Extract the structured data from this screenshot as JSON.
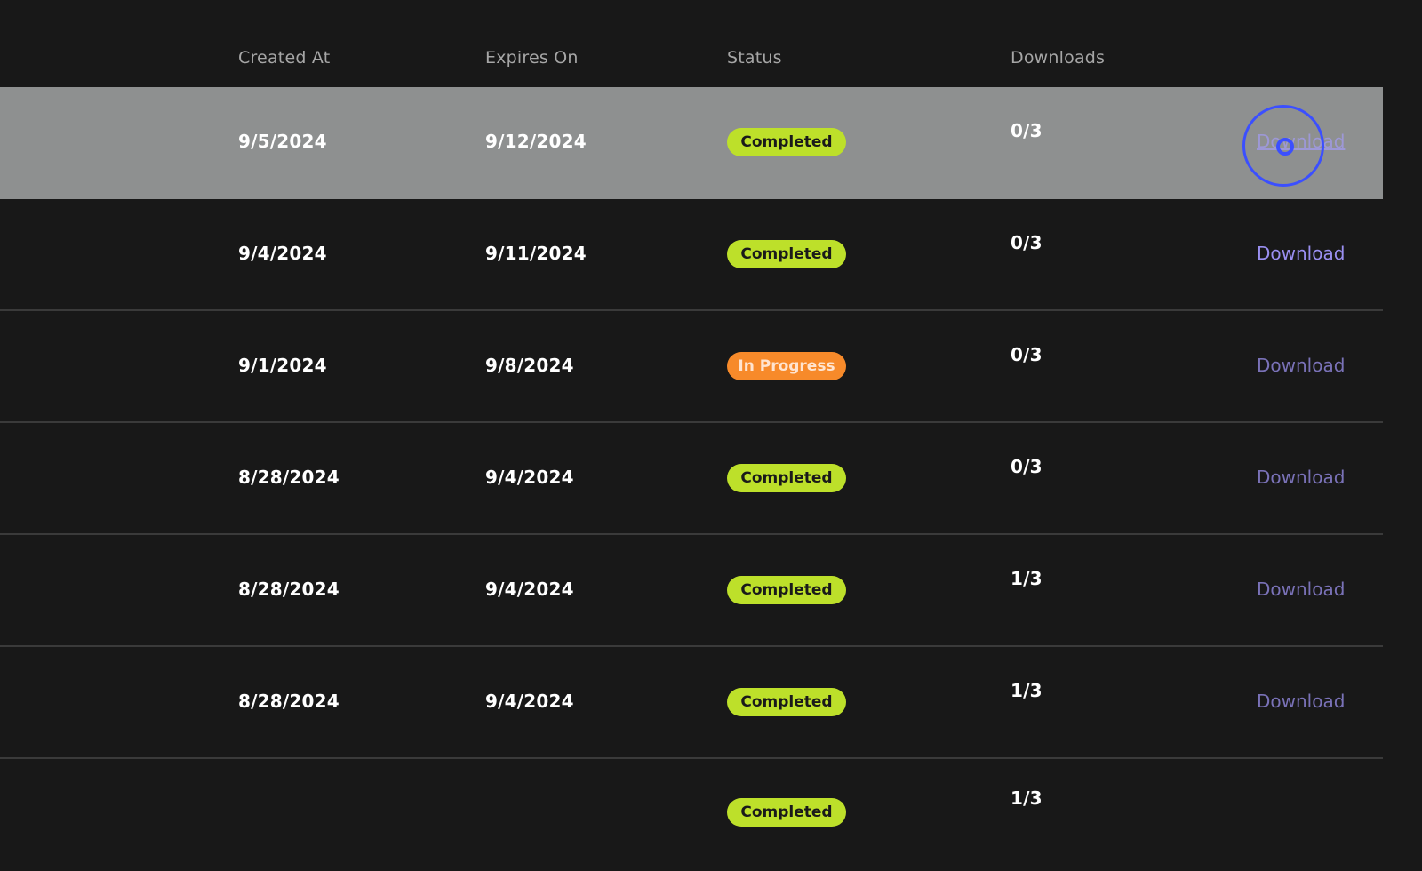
{
  "columns": {
    "created_at": "Created At",
    "expires_on": "Expires On",
    "status": "Status",
    "downloads": "Downloads"
  },
  "rows": [
    {
      "created": "9/5/2024",
      "expires": "9/12/2024",
      "status": "Completed",
      "downloads": "0/3",
      "action": "Download"
    },
    {
      "created": "9/4/2024",
      "expires": "9/11/2024",
      "status": "Completed",
      "downloads": "0/3",
      "action": "Download"
    },
    {
      "created": "9/1/2024",
      "expires": "9/8/2024",
      "status": "In Progress",
      "downloads": "0/3",
      "action": "Download"
    },
    {
      "created": "8/28/2024",
      "expires": "9/4/2024",
      "status": "Completed",
      "downloads": "0/3",
      "action": "Download"
    },
    {
      "created": "8/28/2024",
      "expires": "9/4/2024",
      "status": "Completed",
      "downloads": "1/3",
      "action": "Download"
    },
    {
      "created": "8/28/2024",
      "expires": "9/4/2024",
      "status": "Completed",
      "downloads": "1/3",
      "action": "Download"
    },
    {
      "created": "",
      "expires": "",
      "status": "Completed",
      "downloads": "1/3",
      "action": ""
    }
  ],
  "colors": {
    "background": "#181818",
    "highlight_row": "#8e9090",
    "completed_badge": "#bde02a",
    "in_progress_badge": "#f78a2a",
    "link": "#7a72b8",
    "cursor": "#3b4fff"
  }
}
